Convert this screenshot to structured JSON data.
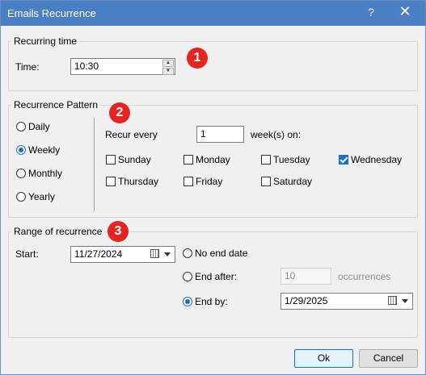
{
  "window": {
    "title": "Emails Recurrence",
    "help_glyph": "?",
    "close_glyph": "✕"
  },
  "recurring_time": {
    "legend": "Recurring time",
    "time_label": "Time:",
    "time_value": "10:30",
    "badge": "1"
  },
  "pattern": {
    "legend": "Recurrence Pattern",
    "badge": "2",
    "options": [
      {
        "label": "Daily",
        "selected": false
      },
      {
        "label": "Weekly",
        "selected": true
      },
      {
        "label": "Monthly",
        "selected": false
      },
      {
        "label": "Yearly",
        "selected": false
      }
    ],
    "recur_every_label": "Recur every",
    "recur_every_value": "1",
    "weeks_on_label": "week(s) on:",
    "days": [
      {
        "label": "Sunday",
        "checked": false
      },
      {
        "label": "Monday",
        "checked": false
      },
      {
        "label": "Tuesday",
        "checked": false
      },
      {
        "label": "Wednesday",
        "checked": true
      },
      {
        "label": "Thursday",
        "checked": false
      },
      {
        "label": "Friday",
        "checked": false
      },
      {
        "label": "Saturday",
        "checked": false
      }
    ]
  },
  "range": {
    "legend": "Range of recurrence",
    "badge": "3",
    "start_label": "Start:",
    "start_value": "11/27/2024",
    "no_end_label": "No end date",
    "end_after_label": "End after:",
    "end_after_value": "10",
    "occurrences_label": "occurrences",
    "end_by_label": "End by:",
    "end_by_value": "1/29/2025",
    "selected": "end_by"
  },
  "buttons": {
    "ok": "Ok",
    "cancel": "Cancel"
  }
}
